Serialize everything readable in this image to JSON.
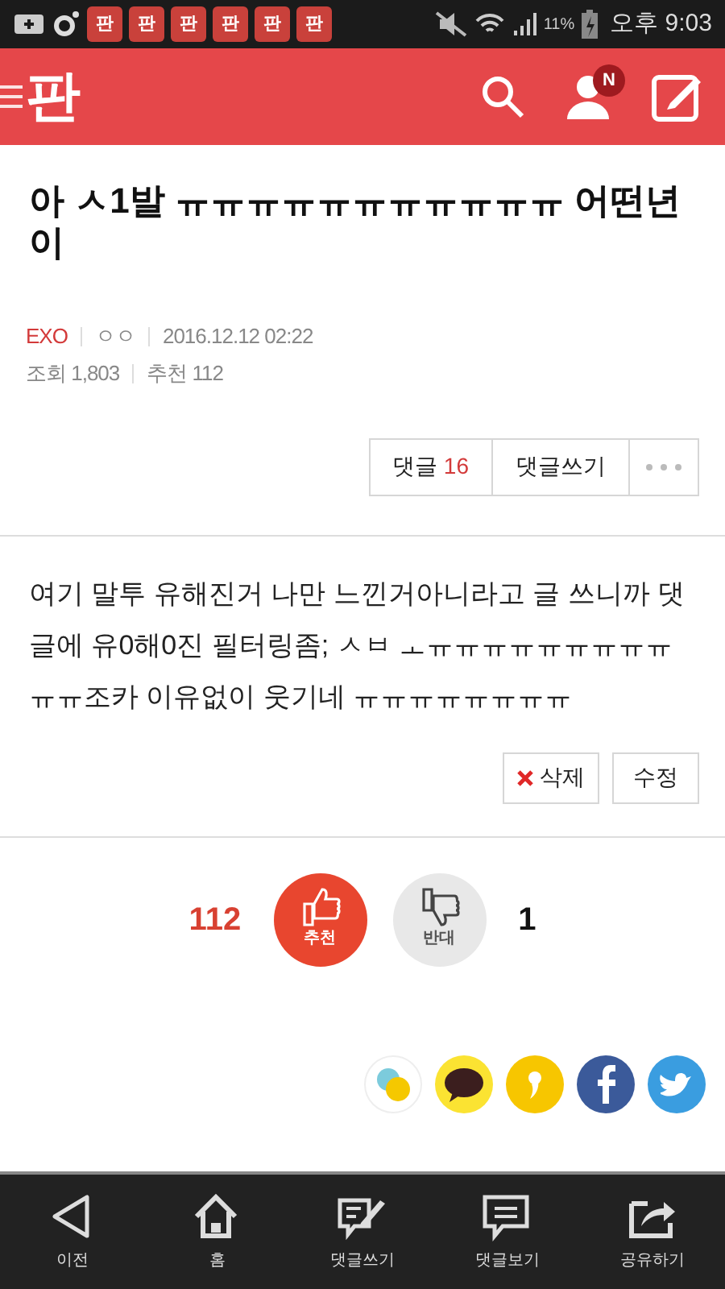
{
  "status_bar": {
    "notifications": [
      "판",
      "판",
      "판",
      "판",
      "판",
      "판"
    ],
    "battery": "11%",
    "time": "오후 9:03"
  },
  "header": {
    "logo": "판",
    "notification_badge": "N"
  },
  "post": {
    "title": "아 ㅅ1발 ㅠㅠㅠㅠㅠㅠㅠㅠㅠㅠㅠ 어떤년이",
    "category": "EXO",
    "author": "ㅇㅇ",
    "date": "2016.12.12 02:22",
    "views_label": "조회",
    "views": "1,803",
    "recommend_label": "추천",
    "recommend": "112"
  },
  "post_actions": {
    "comments_label": "댓글",
    "comments_count": "16",
    "write_comment": "댓글쓰기"
  },
  "body": "여기 말투 유해진거 나만 느낀거아니라고 글 쓰니까 댓글에 유0해0진 필터링좀; ㅅㅂ ㅗㅠㅠㅠㅠㅠㅠㅠㅠㅠㅠㅠ조카 이유없이 웃기네 ㅠㅠㅠㅠㅠㅠㅠㅠ",
  "edit_actions": {
    "delete": "삭제",
    "edit": "수정"
  },
  "votes": {
    "up_count": "112",
    "up_label": "추천",
    "down_label": "반대",
    "down_count": "1"
  },
  "bottom_nav": [
    {
      "kind": "back",
      "label": "이전"
    },
    {
      "kind": "home",
      "label": "홈"
    },
    {
      "kind": "write",
      "label": "댓글쓰기"
    },
    {
      "kind": "comments",
      "label": "댓글보기"
    },
    {
      "kind": "share",
      "label": "공유하기"
    }
  ]
}
